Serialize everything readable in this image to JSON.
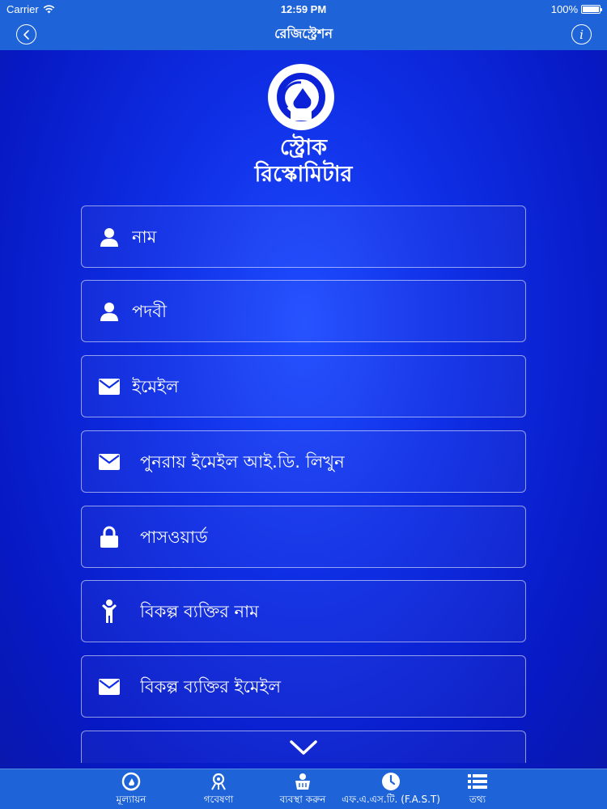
{
  "status_bar": {
    "carrier": "Carrier",
    "time": "12:59 PM",
    "battery": "100%",
    "battery_level": 1.0
  },
  "nav": {
    "title": "রেজিস্ট্রেশন",
    "back_icon": "chevron-left-icon",
    "info_label": "i"
  },
  "app": {
    "title_line1": "স্ট্রোক",
    "title_line2": "রিস্কোমিটার",
    "logo_icon": "gauge-logo-icon"
  },
  "form": {
    "fields": [
      {
        "placeholder": "নাম",
        "icon": "person-icon"
      },
      {
        "placeholder": "পদবী",
        "icon": "person-icon"
      },
      {
        "placeholder": "ইমেইল",
        "icon": "envelope-icon"
      },
      {
        "placeholder": "পুনরায় ইমেইল আই.ডি. লিখুন",
        "icon": "envelope-icon"
      },
      {
        "placeholder": "পাসওয়ার্ড",
        "icon": "lock-icon"
      },
      {
        "placeholder": "বিকল্প ব্যক্তির নাম",
        "icon": "child-icon"
      },
      {
        "placeholder": "বিকল্প ব্যক্তির ইমেইল",
        "icon": "envelope-icon"
      }
    ]
  },
  "tabs": [
    {
      "label": "মূল্যায়ন",
      "icon": "gauge-icon"
    },
    {
      "label": "গবেষণা",
      "icon": "research-icon"
    },
    {
      "label": "ব্যবস্থা করুন",
      "icon": "basket-icon"
    },
    {
      "label": "এফ.এ.এস.টি. (F.A.S.T)",
      "icon": "clock-icon"
    },
    {
      "label": "তথ্য",
      "icon": "list-icon"
    }
  ],
  "colors": {
    "bar": "#1e64d8",
    "background": "#0f2fe6",
    "text": "#ffffff"
  }
}
